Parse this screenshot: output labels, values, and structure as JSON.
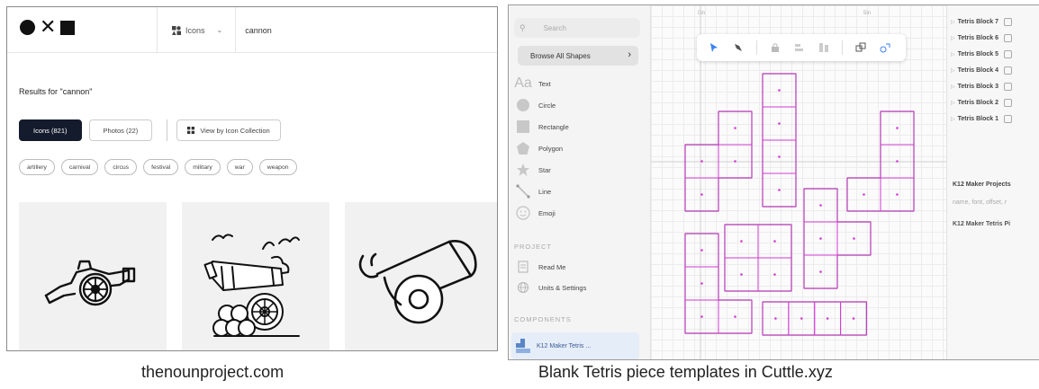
{
  "left_panel": {
    "search_type": "Icons",
    "search_query": "cannon",
    "results_title": "Results for \"cannon\"",
    "tab_icons": "Icons (821)",
    "tab_photos": "Photos (22)",
    "collection_button": "View by Icon Collection",
    "tags": [
      "artillery",
      "carnival",
      "circus",
      "festival",
      "military",
      "war",
      "weapon"
    ]
  },
  "right_panel": {
    "search_placeholder": "Search",
    "browse_label": "Browse All Shapes",
    "shapes": [
      "Text",
      "Circle",
      "Rectangle",
      "Polygon",
      "Star",
      "Line",
      "Emoji"
    ],
    "text_shape_glyph": "Aa",
    "project_section": "PROJECT",
    "project_items": [
      "Read Me",
      "Units & Settings"
    ],
    "components_section": "COMPONENTS",
    "component_item": "K12 Maker Tetris ...",
    "ruler_labels": [
      "0in",
      "5in"
    ],
    "layers": [
      "Tetris Block 7",
      "Tetris Block 6",
      "Tetris Block 5",
      "Tetris Block 4",
      "Tetris Block 3",
      "Tetris Block 2",
      "Tetris Block 1"
    ],
    "project_name": "K12 Maker Projects",
    "project_params": "name, font, offset, r",
    "component_name": "K12 Maker Tetris Pi",
    "accent_color": "#d23bd2"
  },
  "captions": {
    "left": "thenounproject.com",
    "right": "Blank Tetris piece templates in Cuttle.xyz"
  }
}
